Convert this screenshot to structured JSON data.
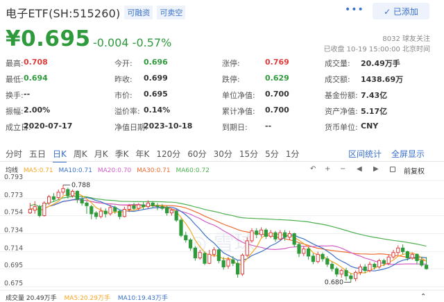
{
  "header": {
    "title": "电子ETF(SH:515260)",
    "tag1": "可融资",
    "tag2": "可卖空",
    "more": "•••",
    "add_label": "✓ 已添加"
  },
  "quote": {
    "price": "¥0.695",
    "change": "-0.004 -0.57%",
    "followers": "8032 球友关注",
    "closed": "已收盘 10-19 15:00:00 北京时间"
  },
  "stats": [
    {
      "label": "最高:",
      "value": "0.708",
      "color": "red"
    },
    {
      "label": "今开:",
      "value": "0.696",
      "color": "grn"
    },
    {
      "label": "涨停:",
      "value": "0.769",
      "color": "red"
    },
    {
      "label": "成交量:",
      "value": "20.49万手",
      "color": "blk"
    },
    {
      "label": "最低:",
      "value": "0.694",
      "color": "grn"
    },
    {
      "label": "昨收:",
      "value": "0.699",
      "color": "blk"
    },
    {
      "label": "跌停:",
      "value": "0.629",
      "color": "grn"
    },
    {
      "label": "成交额:",
      "value": "1438.69万",
      "color": "blk"
    },
    {
      "label": "换手:",
      "value": "--",
      "color": "blk"
    },
    {
      "label": "市价:",
      "value": "0.695",
      "color": "blk"
    },
    {
      "label": "单位净值:",
      "value": "0.700",
      "color": "blk"
    },
    {
      "label": "基金份额:",
      "value": "7.43亿",
      "color": "blk"
    },
    {
      "label": "振幅:",
      "value": "2.00%",
      "color": "blk"
    },
    {
      "label": "溢价率:",
      "value": "0.14%",
      "color": "blk"
    },
    {
      "label": "累计净值:",
      "value": "0.700",
      "color": "blk"
    },
    {
      "label": "资产净值:",
      "value": "5.17亿",
      "color": "blk"
    },
    {
      "label": "成立日:",
      "value": "2020-07-17",
      "color": "blk"
    },
    {
      "label": "净值日期:",
      "value": "2023-10-18",
      "color": "blk"
    },
    {
      "label": "到期日:",
      "value": "--",
      "color": "blk"
    },
    {
      "label": "货币单位:",
      "value": "CNY",
      "color": "blk"
    }
  ],
  "tabs": [
    "分时",
    "五日",
    "日K",
    "周K",
    "月K",
    "季K",
    "年K",
    "120分",
    "60分",
    "30分",
    "15分",
    "5分",
    "1分"
  ],
  "links": {
    "interval": "区间统计",
    "fullscreen": "全屏显示"
  },
  "ma_legend": {
    "label": "均线",
    "ma5": "MA5:0.71",
    "ma10": "MA10:0.71",
    "ma20": "MA20:0.70",
    "ma30": "MA30:0.71",
    "ma60": "MA60:0.72"
  },
  "chart_tools": {
    "undo": "↶",
    "plus": "+",
    "minus": "−",
    "left": "◀",
    "right": "▶",
    "fq": "前复权"
  },
  "volume_legend": {
    "label": "成交量 20.49万手",
    "ma5": "MA5:20.29万手",
    "ma10": "MA10:19.43万手"
  },
  "colors": {
    "up": "#e03b3b",
    "down": "#2e9a3b",
    "accent": "#3a70c9",
    "ma5": "#f5a623",
    "ma10": "#3a70c9",
    "ma20": "#d35ec7",
    "ma30": "#ee6a2f",
    "ma60": "#4caf50"
  },
  "chart_data": {
    "type": "candlestick",
    "ylim": [
      0.675,
      0.793
    ],
    "yticks": [
      "0.793",
      "0.773",
      "0.754",
      "0.734",
      "0.714",
      "0.695",
      "0.675"
    ],
    "max_label": "0.788",
    "min_label": "0.680",
    "candles": [
      {
        "o": 0.757,
        "c": 0.761,
        "h": 0.768,
        "l": 0.756
      },
      {
        "o": 0.76,
        "c": 0.764,
        "h": 0.77,
        "l": 0.756
      },
      {
        "o": 0.764,
        "c": 0.754,
        "h": 0.766,
        "l": 0.752
      },
      {
        "o": 0.754,
        "c": 0.768,
        "h": 0.77,
        "l": 0.753
      },
      {
        "o": 0.768,
        "c": 0.775,
        "h": 0.777,
        "l": 0.766
      },
      {
        "o": 0.775,
        "c": 0.772,
        "h": 0.779,
        "l": 0.77
      },
      {
        "o": 0.774,
        "c": 0.78,
        "h": 0.783,
        "l": 0.772
      },
      {
        "o": 0.78,
        "c": 0.784,
        "h": 0.788,
        "l": 0.777
      },
      {
        "o": 0.783,
        "c": 0.776,
        "h": 0.785,
        "l": 0.773
      },
      {
        "o": 0.776,
        "c": 0.781,
        "h": 0.783,
        "l": 0.774
      },
      {
        "o": 0.781,
        "c": 0.772,
        "h": 0.782,
        "l": 0.768
      },
      {
        "o": 0.772,
        "c": 0.768,
        "h": 0.775,
        "l": 0.765
      },
      {
        "o": 0.768,
        "c": 0.765,
        "h": 0.77,
        "l": 0.756
      },
      {
        "o": 0.764,
        "c": 0.756,
        "h": 0.766,
        "l": 0.75
      },
      {
        "o": 0.757,
        "c": 0.753,
        "h": 0.759,
        "l": 0.75
      },
      {
        "o": 0.753,
        "c": 0.759,
        "h": 0.763,
        "l": 0.751
      },
      {
        "o": 0.759,
        "c": 0.756,
        "h": 0.762,
        "l": 0.752
      },
      {
        "o": 0.756,
        "c": 0.763,
        "h": 0.766,
        "l": 0.754
      },
      {
        "o": 0.763,
        "c": 0.759,
        "h": 0.765,
        "l": 0.756
      },
      {
        "o": 0.759,
        "c": 0.753,
        "h": 0.76,
        "l": 0.75
      },
      {
        "o": 0.753,
        "c": 0.761,
        "h": 0.764,
        "l": 0.752
      },
      {
        "o": 0.761,
        "c": 0.765,
        "h": 0.767,
        "l": 0.758
      },
      {
        "o": 0.765,
        "c": 0.762,
        "h": 0.768,
        "l": 0.76
      },
      {
        "o": 0.762,
        "c": 0.766,
        "h": 0.768,
        "l": 0.76
      },
      {
        "o": 0.766,
        "c": 0.764,
        "h": 0.769,
        "l": 0.761
      },
      {
        "o": 0.764,
        "c": 0.768,
        "h": 0.771,
        "l": 0.762
      },
      {
        "o": 0.768,
        "c": 0.765,
        "h": 0.77,
        "l": 0.762
      },
      {
        "o": 0.765,
        "c": 0.764,
        "h": 0.768,
        "l": 0.76
      },
      {
        "o": 0.764,
        "c": 0.762,
        "h": 0.767,
        "l": 0.76
      },
      {
        "o": 0.763,
        "c": 0.757,
        "h": 0.765,
        "l": 0.754
      },
      {
        "o": 0.757,
        "c": 0.76,
        "h": 0.762,
        "l": 0.754
      },
      {
        "o": 0.759,
        "c": 0.749,
        "h": 0.761,
        "l": 0.747
      },
      {
        "o": 0.749,
        "c": 0.732,
        "h": 0.751,
        "l": 0.73
      },
      {
        "o": 0.732,
        "c": 0.727,
        "h": 0.736,
        "l": 0.724
      },
      {
        "o": 0.727,
        "c": 0.718,
        "h": 0.729,
        "l": 0.715
      },
      {
        "o": 0.718,
        "c": 0.707,
        "h": 0.72,
        "l": 0.704
      },
      {
        "o": 0.707,
        "c": 0.713,
        "h": 0.716,
        "l": 0.705
      },
      {
        "o": 0.712,
        "c": 0.701,
        "h": 0.714,
        "l": 0.699
      },
      {
        "o": 0.701,
        "c": 0.711,
        "h": 0.716,
        "l": 0.7
      },
      {
        "o": 0.711,
        "c": 0.716,
        "h": 0.719,
        "l": 0.708
      },
      {
        "o": 0.716,
        "c": 0.704,
        "h": 0.717,
        "l": 0.701
      },
      {
        "o": 0.704,
        "c": 0.697,
        "h": 0.708,
        "l": 0.694
      },
      {
        "o": 0.698,
        "c": 0.705,
        "h": 0.708,
        "l": 0.695
      },
      {
        "o": 0.705,
        "c": 0.701,
        "h": 0.709,
        "l": 0.698
      },
      {
        "o": 0.701,
        "c": 0.689,
        "h": 0.704,
        "l": 0.685
      },
      {
        "o": 0.689,
        "c": 0.71,
        "h": 0.712,
        "l": 0.687
      },
      {
        "o": 0.71,
        "c": 0.726,
        "h": 0.73,
        "l": 0.708
      },
      {
        "o": 0.726,
        "c": 0.737,
        "h": 0.74,
        "l": 0.724
      },
      {
        "o": 0.737,
        "c": 0.733,
        "h": 0.74,
        "l": 0.729
      },
      {
        "o": 0.733,
        "c": 0.738,
        "h": 0.741,
        "l": 0.73
      },
      {
        "o": 0.738,
        "c": 0.731,
        "h": 0.74,
        "l": 0.728
      },
      {
        "o": 0.731,
        "c": 0.735,
        "h": 0.738,
        "l": 0.729
      },
      {
        "o": 0.735,
        "c": 0.728,
        "h": 0.737,
        "l": 0.725
      },
      {
        "o": 0.728,
        "c": 0.735,
        "h": 0.738,
        "l": 0.726
      },
      {
        "o": 0.735,
        "c": 0.73,
        "h": 0.738,
        "l": 0.726
      },
      {
        "o": 0.73,
        "c": 0.734,
        "h": 0.737,
        "l": 0.727
      },
      {
        "o": 0.734,
        "c": 0.722,
        "h": 0.735,
        "l": 0.719
      },
      {
        "o": 0.722,
        "c": 0.712,
        "h": 0.724,
        "l": 0.708
      },
      {
        "o": 0.712,
        "c": 0.717,
        "h": 0.72,
        "l": 0.709
      },
      {
        "o": 0.717,
        "c": 0.709,
        "h": 0.719,
        "l": 0.705
      },
      {
        "o": 0.709,
        "c": 0.703,
        "h": 0.712,
        "l": 0.7
      },
      {
        "o": 0.703,
        "c": 0.711,
        "h": 0.714,
        "l": 0.701
      },
      {
        "o": 0.711,
        "c": 0.706,
        "h": 0.713,
        "l": 0.703
      },
      {
        "o": 0.706,
        "c": 0.7,
        "h": 0.709,
        "l": 0.697
      },
      {
        "o": 0.7,
        "c": 0.695,
        "h": 0.703,
        "l": 0.692
      },
      {
        "o": 0.695,
        "c": 0.689,
        "h": 0.697,
        "l": 0.686
      },
      {
        "o": 0.689,
        "c": 0.693,
        "h": 0.695,
        "l": 0.685
      },
      {
        "o": 0.693,
        "c": 0.687,
        "h": 0.696,
        "l": 0.682
      },
      {
        "o": 0.687,
        "c": 0.684,
        "h": 0.69,
        "l": 0.68
      },
      {
        "o": 0.684,
        "c": 0.691,
        "h": 0.693,
        "l": 0.681
      },
      {
        "o": 0.691,
        "c": 0.697,
        "h": 0.7,
        "l": 0.688
      },
      {
        "o": 0.697,
        "c": 0.693,
        "h": 0.7,
        "l": 0.69
      },
      {
        "o": 0.693,
        "c": 0.7,
        "h": 0.703,
        "l": 0.691
      },
      {
        "o": 0.7,
        "c": 0.697,
        "h": 0.702,
        "l": 0.694
      },
      {
        "o": 0.697,
        "c": 0.704,
        "h": 0.706,
        "l": 0.695
      },
      {
        "o": 0.704,
        "c": 0.701,
        "h": 0.706,
        "l": 0.698
      },
      {
        "o": 0.701,
        "c": 0.708,
        "h": 0.711,
        "l": 0.699
      },
      {
        "o": 0.708,
        "c": 0.713,
        "h": 0.716,
        "l": 0.706
      },
      {
        "o": 0.713,
        "c": 0.718,
        "h": 0.721,
        "l": 0.71
      },
      {
        "o": 0.718,
        "c": 0.714,
        "h": 0.722,
        "l": 0.711
      },
      {
        "o": 0.714,
        "c": 0.707,
        "h": 0.715,
        "l": 0.704
      },
      {
        "o": 0.707,
        "c": 0.711,
        "h": 0.713,
        "l": 0.705
      },
      {
        "o": 0.711,
        "c": 0.704,
        "h": 0.712,
        "l": 0.7
      },
      {
        "o": 0.704,
        "c": 0.699,
        "h": 0.708,
        "l": 0.697
      },
      {
        "o": 0.699,
        "c": 0.695,
        "h": 0.708,
        "l": 0.694
      }
    ]
  }
}
